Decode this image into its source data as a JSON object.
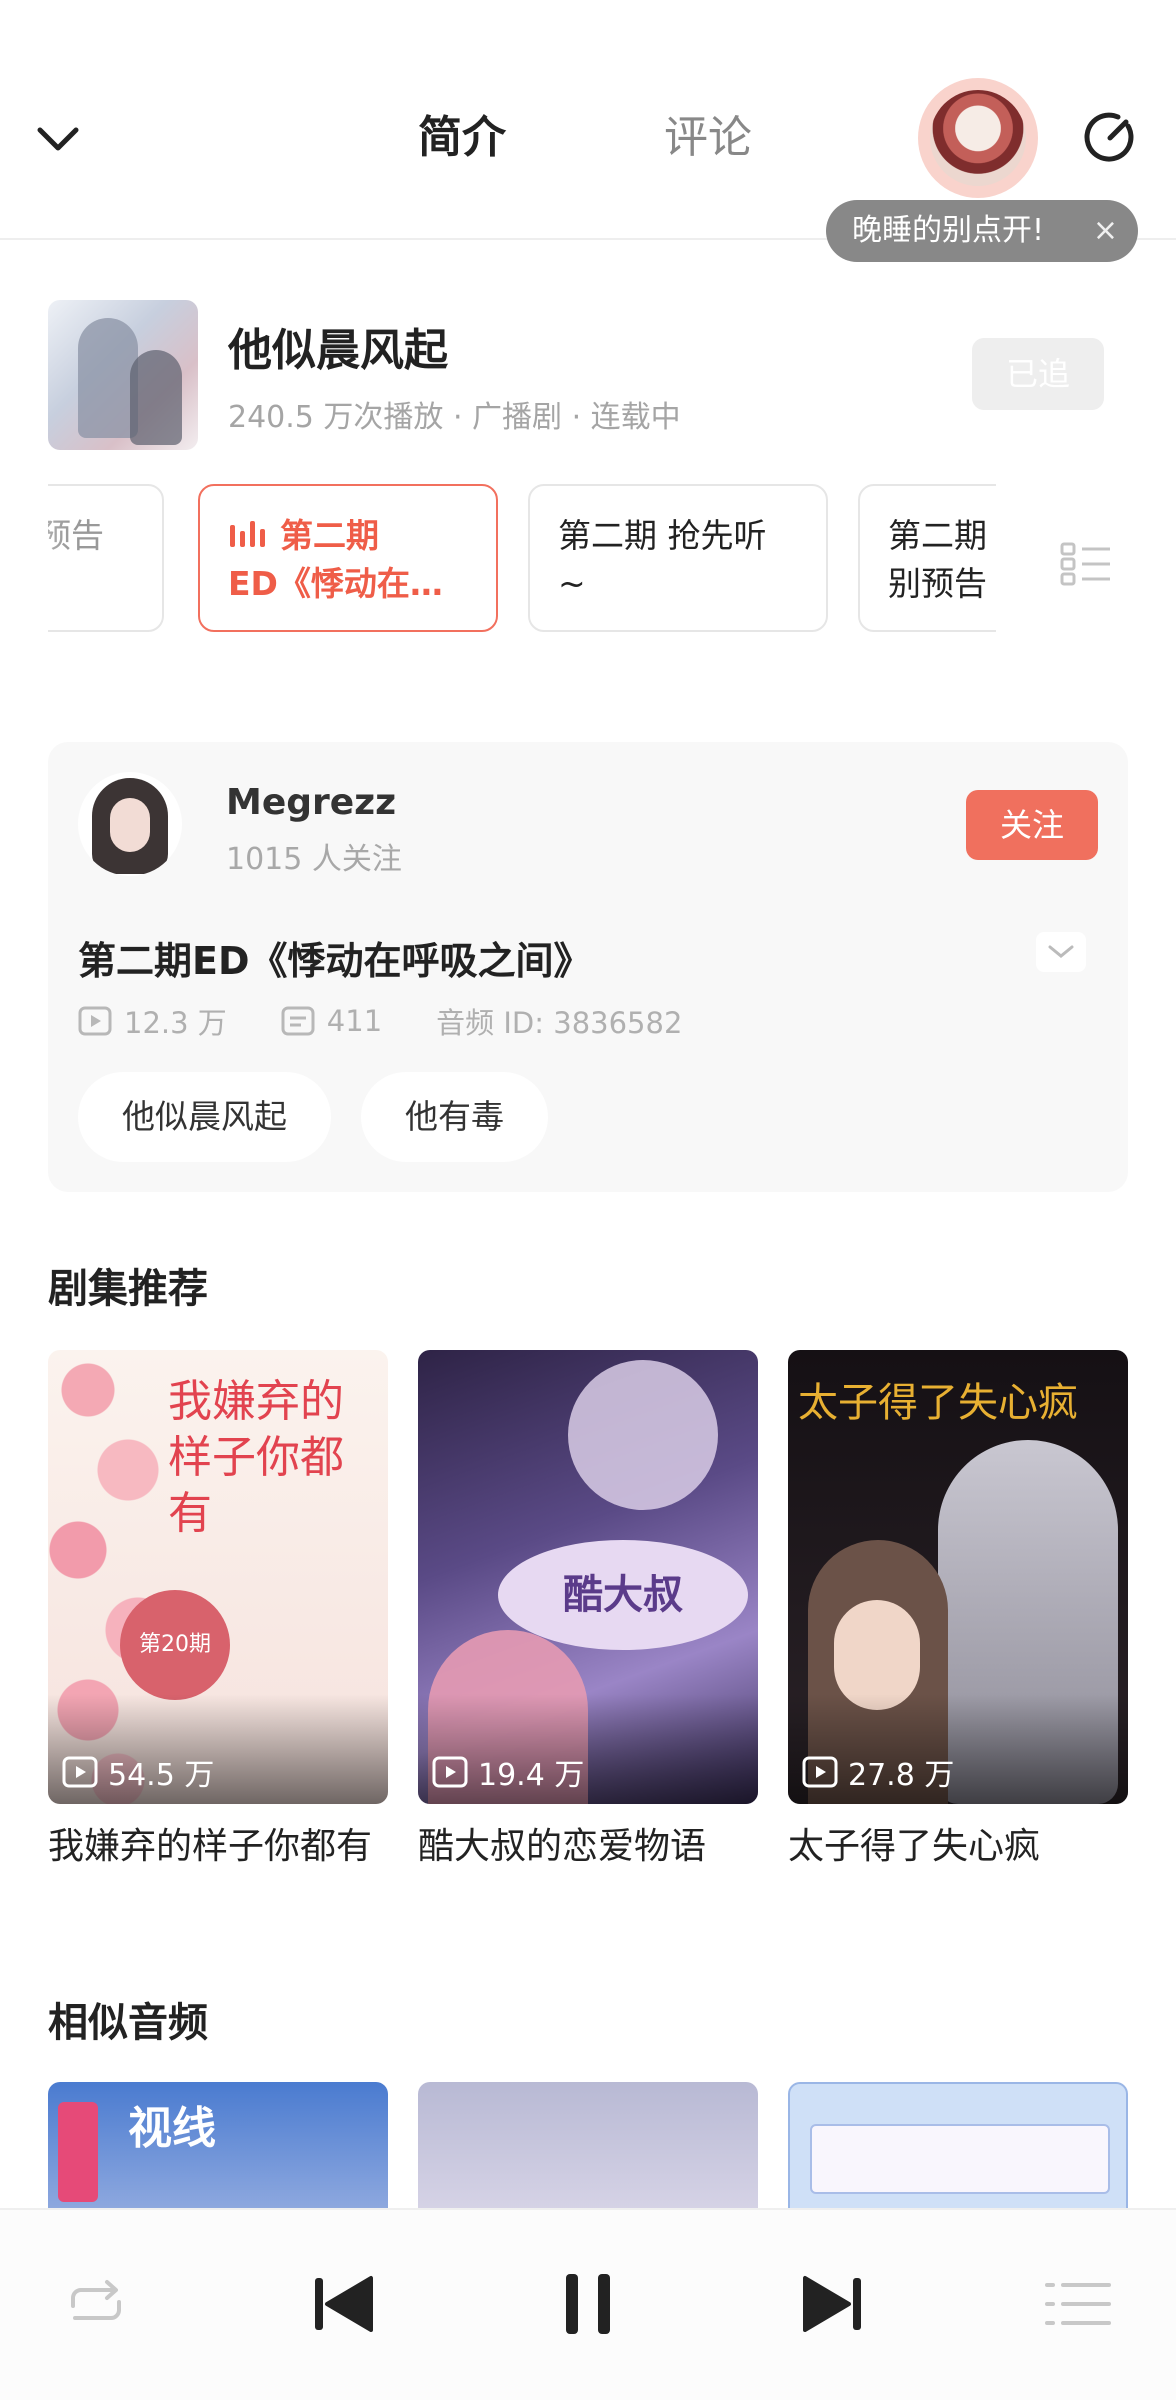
{
  "header": {
    "tabs": [
      {
        "label": "简介",
        "active": true
      },
      {
        "label": "评论",
        "active": false
      }
    ],
    "tooltip": "晚睡的别点开!",
    "tooltip_close": "×"
  },
  "drama": {
    "title": "他似晨风起",
    "meta": "240.5 万次播放 · 广播剧 · 连载中",
    "followed_label": "已追"
  },
  "episodes": [
    {
      "line1": "预告",
      "line2": ""
    },
    {
      "line1": "第二期",
      "line2": "ED《悸动在…",
      "playing": true
    },
    {
      "line1": "第二期 抢先听",
      "line2": "~"
    },
    {
      "line1": "第二期",
      "line2": "别预告"
    }
  ],
  "author": {
    "name": "Megrezz",
    "followers": "1015 人关注",
    "follow_label": "关注"
  },
  "audio": {
    "title": "第二期ED《悸动在呼吸之间》",
    "plays": "12.3 万",
    "danmaku": "411",
    "audio_id": "音频 ID: 3836582",
    "tags": [
      "他似晨风起",
      "他有毒"
    ]
  },
  "sections": {
    "recommend_title": "剧集推荐",
    "similar_title": "相似音频"
  },
  "recommendations": [
    {
      "title": "我嫌弃的样子你都有",
      "plays": "54.5 万",
      "cover_text": "我嫌弃的样子你都有",
      "badge": "第20期"
    },
    {
      "title": "酷大叔的恋爱物语",
      "plays": "19.4 万",
      "cover_text": "酷大叔"
    },
    {
      "title": "太子得了失心疯",
      "plays": "27.8 万",
      "cover_text": "太子得了失心疯"
    }
  ],
  "similar": [
    {
      "cover_text": "视线"
    },
    {
      "cover_text": ""
    },
    {
      "cover_text": ""
    }
  ],
  "colors": {
    "accent": "#f0705e",
    "accent_text": "#ef5d48",
    "muted": "#a5a5a5",
    "tooltip_bg": "#888888"
  },
  "icons": {
    "back": "chevron-down-icon",
    "timer": "timer-icon",
    "episode_list": "list-icon",
    "repeat": "repeat-icon",
    "prev": "skip-previous-icon",
    "pause": "pause-icon",
    "next": "skip-next-icon",
    "playlist": "playlist-icon"
  }
}
